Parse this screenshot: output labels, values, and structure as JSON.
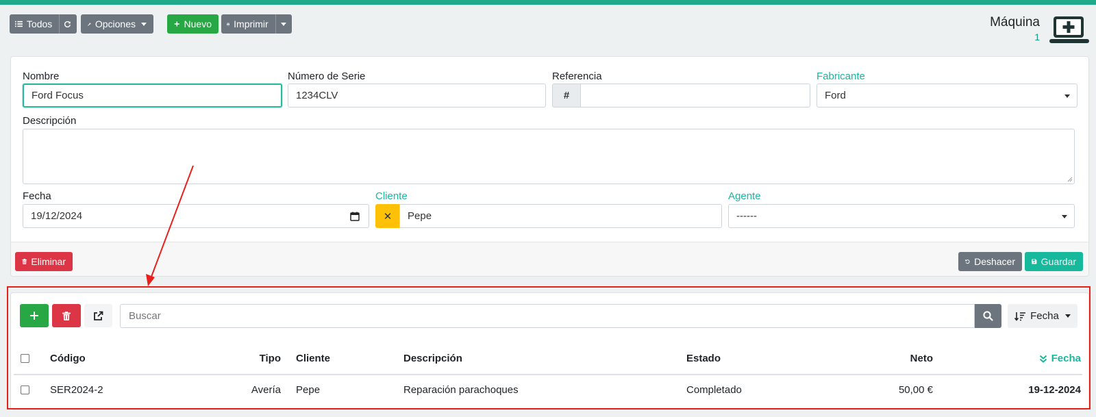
{
  "toolbar": {
    "all_label": "Todos",
    "options_label": "Opciones",
    "new_label": "Nuevo",
    "print_label": "Imprimir"
  },
  "header": {
    "title": "Máquina",
    "count": "1"
  },
  "form": {
    "name_label": "Nombre",
    "name_value": "Ford Focus",
    "serial_label": "Número de Serie",
    "serial_value": "1234CLV",
    "reference_label": "Referencia",
    "reference_addon": "#",
    "reference_value": "",
    "manufacturer_label": "Fabricante",
    "manufacturer_value": "Ford",
    "description_label": "Descripción",
    "description_value": "",
    "date_label": "Fecha",
    "date_value": "19/12/2024",
    "client_label": "Cliente",
    "client_clear": "✕",
    "client_value": "Pepe",
    "agent_label": "Agente",
    "agent_value": "------",
    "delete_label": "Eliminar",
    "undo_label": "Deshacer",
    "save_label": "Guardar"
  },
  "list": {
    "search_placeholder": "Buscar",
    "sort_label": "Fecha",
    "columns": {
      "code": "Código",
      "type": "Tipo",
      "client": "Cliente",
      "description": "Descripción",
      "status": "Estado",
      "net": "Neto",
      "date": "Fecha"
    },
    "rows": [
      {
        "code": "SER2024-2",
        "type": "Avería",
        "client": "Pepe",
        "description": "Reparación parachoques",
        "status": "Completado",
        "net": "50,00 €",
        "date": "19-12-2024"
      }
    ]
  },
  "colors": {
    "accent": "#18b89d",
    "primary_green": "#28a745",
    "danger": "#dc3545",
    "secondary": "#6c757d",
    "warning": "#ffc107",
    "highlight_box": "#e8201c"
  }
}
